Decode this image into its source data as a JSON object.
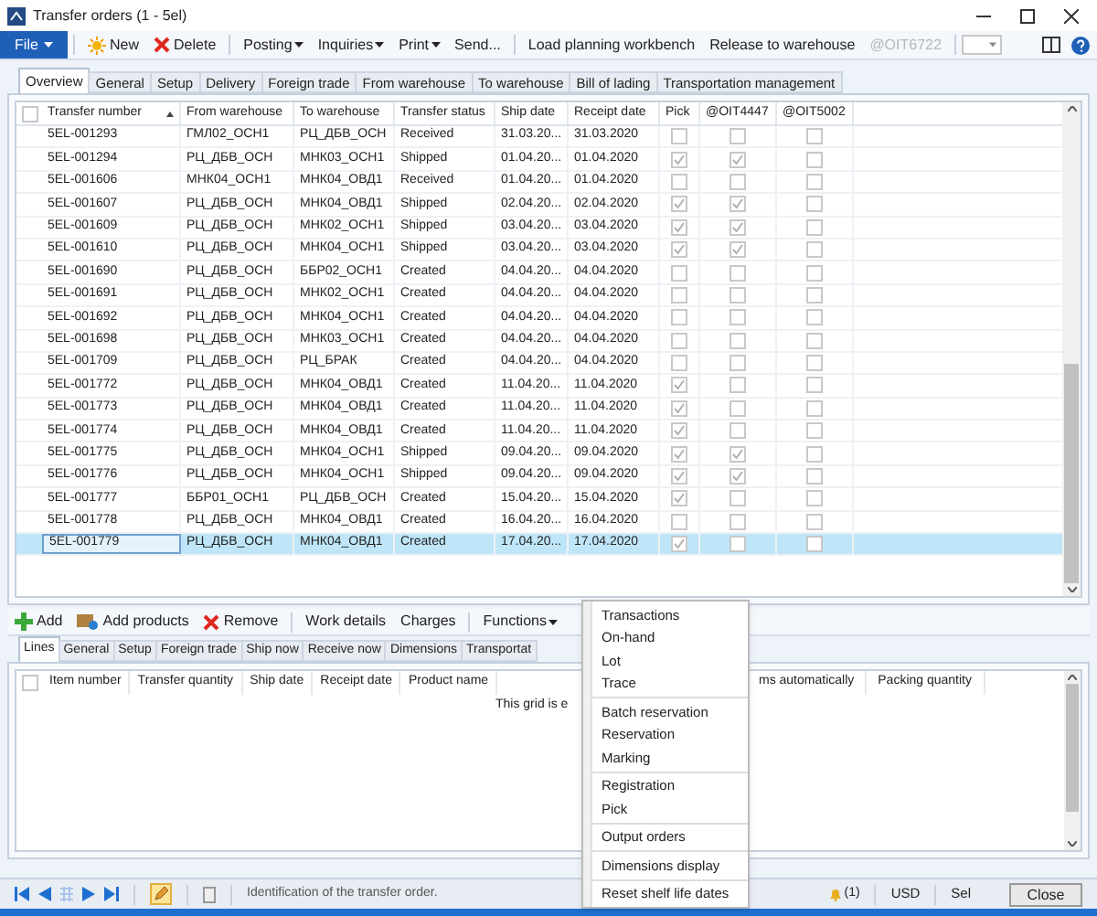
{
  "window": {
    "title": "Transfer orders (1 - 5el)"
  },
  "action_pane": {
    "groups": [
      [
        {
          "label": "File",
          "kind": "file"
        }
      ],
      [
        {
          "label": "New",
          "kind": "new"
        },
        {
          "label": "Delete",
          "kind": "delete"
        }
      ],
      [
        {
          "label": "Posting",
          "kind": "menu"
        },
        {
          "label": "Inquiries",
          "kind": "menu"
        },
        {
          "label": "Print",
          "kind": "menu"
        },
        {
          "label": "Send...",
          "kind": "button"
        }
      ],
      [
        {
          "label": "Load planning workbench",
          "kind": "button"
        },
        {
          "label": "Release to warehouse",
          "kind": "button"
        },
        {
          "label": "@OIT6722",
          "kind": "disabled"
        }
      ]
    ]
  },
  "header_tabs": [
    {
      "label": "Overview",
      "selected": true
    },
    {
      "label": "General",
      "selected": false
    },
    {
      "label": "Setup",
      "selected": false
    },
    {
      "label": "Delivery",
      "selected": false
    },
    {
      "label": "Foreign trade",
      "selected": false
    },
    {
      "label": "From warehouse",
      "selected": false
    },
    {
      "label": "To warehouse",
      "selected": false
    },
    {
      "label": "Bill of lading",
      "selected": false
    },
    {
      "label": "Transportation management",
      "selected": false
    }
  ],
  "grid": {
    "select_all_checked": false,
    "columns": [
      {
        "label": "Transfer number",
        "sorted": true
      },
      {
        "label": "From warehouse",
        "sorted": false
      },
      {
        "label": "To warehouse",
        "sorted": false
      },
      {
        "label": "Transfer status",
        "sorted": false
      },
      {
        "label": "Ship date",
        "sorted": false
      },
      {
        "label": "Receipt date",
        "sorted": false
      },
      {
        "label": "Pick",
        "sorted": false
      },
      {
        "label": "@OIT4447",
        "sorted": false
      },
      {
        "label": "@OIT5002",
        "sorted": false
      }
    ],
    "rows": [
      {
        "cells": [
          "5EL-001293",
          "ГМЛ02_ОСН1",
          "РЦ_ДБВ_ОСН",
          "Received",
          "31.03.20...",
          "31.03.2020"
        ],
        "checks": [
          false,
          false,
          false
        ],
        "selected": false
      },
      {
        "cells": [
          "5EL-001294",
          "РЦ_ДБВ_ОСН",
          "МНК03_ОСН1",
          "Shipped",
          "01.04.20...",
          "01.04.2020"
        ],
        "checks": [
          true,
          true,
          false
        ],
        "selected": false
      },
      {
        "cells": [
          "5EL-001606",
          "МНК04_ОСН1",
          "МНК04_ОВД1",
          "Received",
          "01.04.20...",
          "01.04.2020"
        ],
        "checks": [
          false,
          false,
          false
        ],
        "selected": false
      },
      {
        "cells": [
          "5EL-001607",
          "РЦ_ДБВ_ОСН",
          "МНК04_ОВД1",
          "Shipped",
          "02.04.20...",
          "02.04.2020"
        ],
        "checks": [
          true,
          true,
          false
        ],
        "selected": false
      },
      {
        "cells": [
          "5EL-001609",
          "РЦ_ДБВ_ОСН",
          "МНК02_ОСН1",
          "Shipped",
          "03.04.20...",
          "03.04.2020"
        ],
        "checks": [
          true,
          true,
          false
        ],
        "selected": false
      },
      {
        "cells": [
          "5EL-001610",
          "РЦ_ДБВ_ОСН",
          "МНК04_ОСН1",
          "Shipped",
          "03.04.20...",
          "03.04.2020"
        ],
        "checks": [
          true,
          true,
          false
        ],
        "selected": false
      },
      {
        "cells": [
          "5EL-001690",
          "РЦ_ДБВ_ОСН",
          "ББР02_ОСН1",
          "Created",
          "04.04.20...",
          "04.04.2020"
        ],
        "checks": [
          false,
          false,
          false
        ],
        "selected": false
      },
      {
        "cells": [
          "5EL-001691",
          "РЦ_ДБВ_ОСН",
          "МНК02_ОСН1",
          "Created",
          "04.04.20...",
          "04.04.2020"
        ],
        "checks": [
          false,
          false,
          false
        ],
        "selected": false
      },
      {
        "cells": [
          "5EL-001692",
          "РЦ_ДБВ_ОСН",
          "МНК04_ОСН1",
          "Created",
          "04.04.20...",
          "04.04.2020"
        ],
        "checks": [
          false,
          false,
          false
        ],
        "selected": false
      },
      {
        "cells": [
          "5EL-001698",
          "РЦ_ДБВ_ОСН",
          "МНК03_ОСН1",
          "Created",
          "04.04.20...",
          "04.04.2020"
        ],
        "checks": [
          false,
          false,
          false
        ],
        "selected": false
      },
      {
        "cells": [
          "5EL-001709",
          "РЦ_ДБВ_ОСН",
          "РЦ_БРАК",
          "Created",
          "04.04.20...",
          "04.04.2020"
        ],
        "checks": [
          false,
          false,
          false
        ],
        "selected": false
      },
      {
        "cells": [
          "5EL-001772",
          "РЦ_ДБВ_ОСН",
          "МНК04_ОВД1",
          "Created",
          "11.04.20...",
          "11.04.2020"
        ],
        "checks": [
          true,
          false,
          false
        ],
        "selected": false
      },
      {
        "cells": [
          "5EL-001773",
          "РЦ_ДБВ_ОСН",
          "МНК04_ОВД1",
          "Created",
          "11.04.20...",
          "11.04.2020"
        ],
        "checks": [
          true,
          false,
          false
        ],
        "selected": false
      },
      {
        "cells": [
          "5EL-001774",
          "РЦ_ДБВ_ОСН",
          "МНК04_ОВД1",
          "Created",
          "11.04.20...",
          "11.04.2020"
        ],
        "checks": [
          true,
          false,
          false
        ],
        "selected": false
      },
      {
        "cells": [
          "5EL-001775",
          "РЦ_ДБВ_ОСН",
          "МНК04_ОСН1",
          "Shipped",
          "09.04.20...",
          "09.04.2020"
        ],
        "checks": [
          true,
          true,
          false
        ],
        "selected": false
      },
      {
        "cells": [
          "5EL-001776",
          "РЦ_ДБВ_ОСН",
          "МНК04_ОСН1",
          "Shipped",
          "09.04.20...",
          "09.04.2020"
        ],
        "checks": [
          true,
          true,
          false
        ],
        "selected": false
      },
      {
        "cells": [
          "5EL-001777",
          "ББР01_ОСН1",
          "РЦ_ДБВ_ОСН",
          "Created",
          "15.04.20...",
          "15.04.2020"
        ],
        "checks": [
          true,
          false,
          false
        ],
        "selected": false
      },
      {
        "cells": [
          "5EL-001778",
          "РЦ_ДБВ_ОСН",
          "МНК04_ОВД1",
          "Created",
          "16.04.20...",
          "16.04.2020"
        ],
        "checks": [
          false,
          false,
          false
        ],
        "selected": false
      },
      {
        "cells": [
          "5EL-001779",
          "РЦ_ДБВ_ОСН",
          "МНК04_ОВД1",
          "Created",
          "17.04.20...",
          "17.04.2020"
        ],
        "checks": [
          true,
          false,
          false
        ],
        "selected": true
      }
    ]
  },
  "lines_action_pane": [
    {
      "label": "Add",
      "kind": "add"
    },
    {
      "label": "Add products",
      "kind": "products"
    },
    {
      "label": "Remove",
      "kind": "remove"
    },
    {
      "label": "Work details",
      "kind": "button"
    },
    {
      "label": "Charges",
      "kind": "button"
    },
    {
      "label": "Functions",
      "kind": "menu"
    }
  ],
  "lines_tabs": [
    {
      "label": "Lines",
      "selected": true
    },
    {
      "label": "General",
      "selected": false
    },
    {
      "label": "Setup",
      "selected": false
    },
    {
      "label": "Foreign trade",
      "selected": false
    },
    {
      "label": "Ship now",
      "selected": false
    },
    {
      "label": "Receive now",
      "selected": false
    },
    {
      "label": "Dimensions",
      "selected": false
    },
    {
      "label": "Transportat",
      "selected": false
    }
  ],
  "lines_grid": {
    "select_all_checked": false,
    "columns": [
      "Item number",
      "Transfer quantity",
      "Ship date",
      "Receipt date",
      "Product name"
    ],
    "hidden_columns": [
      "ms automatically",
      "Packing quantity"
    ],
    "empty_message": "This grid is e"
  },
  "functions_menu": [
    [
      "Transactions",
      "On-hand",
      "Lot",
      "Trace"
    ],
    [
      "Batch reservation",
      "Reservation",
      "Marking"
    ],
    [
      "Registration",
      "Pick"
    ],
    [
      "Output orders"
    ],
    [
      "Dimensions display"
    ],
    [
      "Reset shelf life dates"
    ]
  ],
  "status_bar": {
    "edit_mode": true,
    "help_text": "Identification of the transfer order.",
    "notifications": "(1)",
    "currency": "USD",
    "company": "Sel",
    "close": "Close"
  }
}
